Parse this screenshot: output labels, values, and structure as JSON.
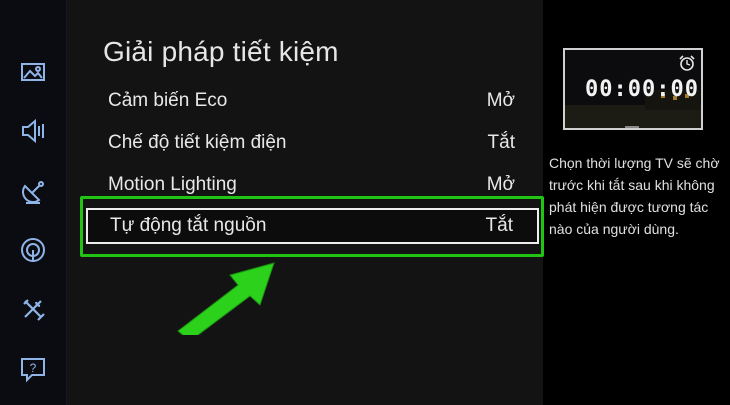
{
  "sidebar": {
    "items": [
      {
        "icon": "picture-icon"
      },
      {
        "icon": "sound-icon"
      },
      {
        "icon": "broadcast-icon"
      },
      {
        "icon": "network-icon"
      },
      {
        "icon": "tools-icon"
      },
      {
        "icon": "support-icon"
      }
    ]
  },
  "menu": {
    "title": "Giải pháp tiết kiệm",
    "items": [
      {
        "label": "Cảm biến Eco",
        "value": "Mở"
      },
      {
        "label": "Chế độ tiết kiệm điện",
        "value": "Tắt"
      },
      {
        "label": "Motion Lighting",
        "value": "Mở"
      },
      {
        "label": "Tự động tắt nguồn",
        "value": "Tắt",
        "selected": true
      }
    ]
  },
  "preview": {
    "timer": "00:00:00",
    "icon": "alarm-clock-icon"
  },
  "description": "Chọn thời lượng TV sẽ chờ trước khi tắt sau khi không phát hiện được tương tác nào của người dùng.",
  "colors": {
    "highlight": "#22c414",
    "background": "#131313",
    "sidebar": "#0a0c11"
  }
}
